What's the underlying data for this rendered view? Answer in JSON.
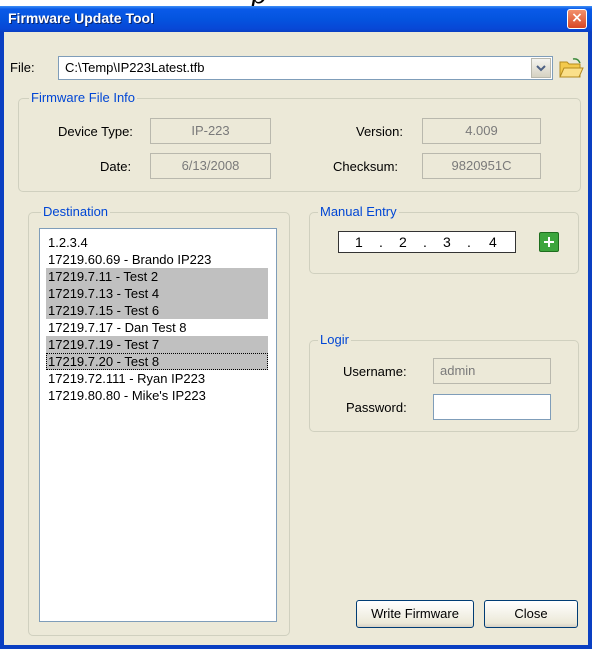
{
  "page_heading_fragment": "p",
  "window": {
    "title": "Firmware Update Tool",
    "close_glyph": "×"
  },
  "file": {
    "label": "File:",
    "path": "C:\\Temp\\IP223Latest.tfb"
  },
  "firmware_info": {
    "legend": "Firmware File Info",
    "device_type_label": "Device Type:",
    "device_type": "IP-223",
    "version_label": "Version:",
    "version": "4.009",
    "date_label": "Date:",
    "date": "6/13/2008",
    "checksum_label": "Checksum:",
    "checksum": "9820951C"
  },
  "destination": {
    "legend": "Destination",
    "items": [
      {
        "text": "1.2.3.4",
        "selected": false
      },
      {
        "text": "17219.60.69 - Brando IP223",
        "selected": false
      },
      {
        "text": "17219.7.11 - Test 2",
        "selected": true
      },
      {
        "text": "17219.7.13 - Test 4",
        "selected": true
      },
      {
        "text": "17219.7.15 - Test 6",
        "selected": true
      },
      {
        "text": "17219.7.17 - Dan Test 8",
        "selected": false
      },
      {
        "text": "17219.7.19 - Test 7",
        "selected": true
      },
      {
        "text": "17219.7.20 - Test 8",
        "selected": true,
        "focused": true
      },
      {
        "text": "17219.72.111 - Ryan IP223",
        "selected": false
      },
      {
        "text": "17219.80.80 - Mike's IP223",
        "selected": false
      }
    ]
  },
  "manual_entry": {
    "legend": "Manual Entry",
    "octets": [
      "1",
      "2",
      "3",
      "4"
    ],
    "separator": "."
  },
  "login": {
    "legend": "Logir",
    "username_label": "Username:",
    "username_value": "admin",
    "password_label": "Password:",
    "password_value": ""
  },
  "buttons": {
    "write_firmware": "Write Firmware",
    "close": "Close"
  },
  "colors": {
    "title_bar": "#0454df",
    "dialog_bg": "#ece9d8",
    "legend_text": "#0046d5",
    "selection": "#c0c0c0"
  },
  "icons": [
    "chevron-down-icon",
    "folder-open-icon",
    "plus-icon",
    "close-icon"
  ]
}
